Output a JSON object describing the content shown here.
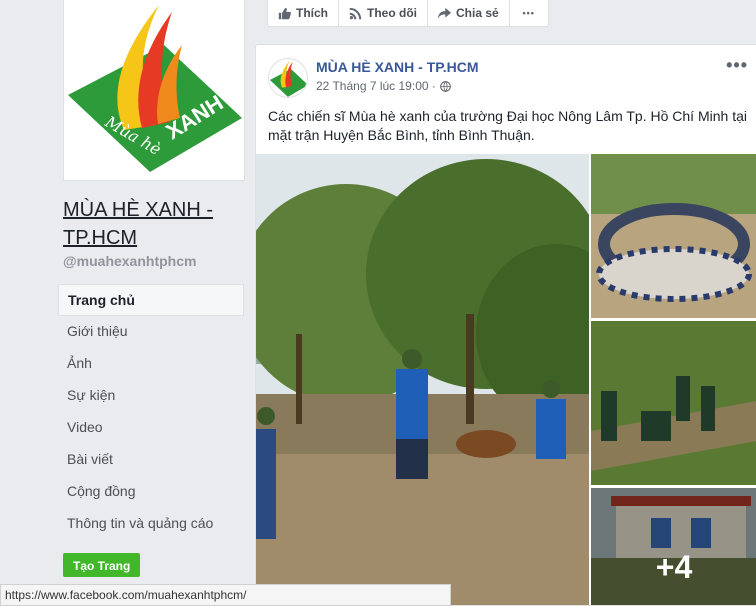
{
  "page": {
    "name": "MÙA HÈ XANH - TP.HCM",
    "handle": "@muahexanhtphcm",
    "logo_text": "Mùa hè XANH"
  },
  "nav": {
    "items": [
      {
        "label": "Trang chủ",
        "active": true
      },
      {
        "label": "Giới thiệu"
      },
      {
        "label": "Ảnh"
      },
      {
        "label": "Sự kiện"
      },
      {
        "label": "Video"
      },
      {
        "label": "Bài viết"
      },
      {
        "label": "Cộng đồng"
      },
      {
        "label": "Thông tin và quảng cáo"
      }
    ],
    "create_page_label": "Tạo Trang"
  },
  "actions": {
    "like_label": "Thích",
    "follow_label": "Theo dõi",
    "share_label": "Chia sẻ",
    "more_label": "•••",
    "icons": [
      "thumbs-up-icon",
      "rss-icon",
      "share-arrow-icon",
      "more-dots-icon"
    ]
  },
  "post": {
    "author": "MÙA HÈ XANH - TP.HCM",
    "time": "22 Tháng 7 lúc 19:00 ·",
    "privacy_icon": "globe-icon",
    "more_label": "•••",
    "text": "Các chiến sĩ Mùa hè xanh của trường Đại học Nông Lâm Tp. Hồ Chí Minh tại mặt trận Huyện Bắc Bình, tỉnh Bình Thuận.",
    "extra_photos_label": "+4"
  },
  "status_bar": {
    "url": "https://www.facebook.com/muahexanhtphcm/"
  },
  "colors": {
    "link": "#385898",
    "create_button": "#42b72a",
    "logo_green": "#2e9b3a",
    "logo_red": "#e63a24",
    "logo_yellow": "#f5c518"
  }
}
